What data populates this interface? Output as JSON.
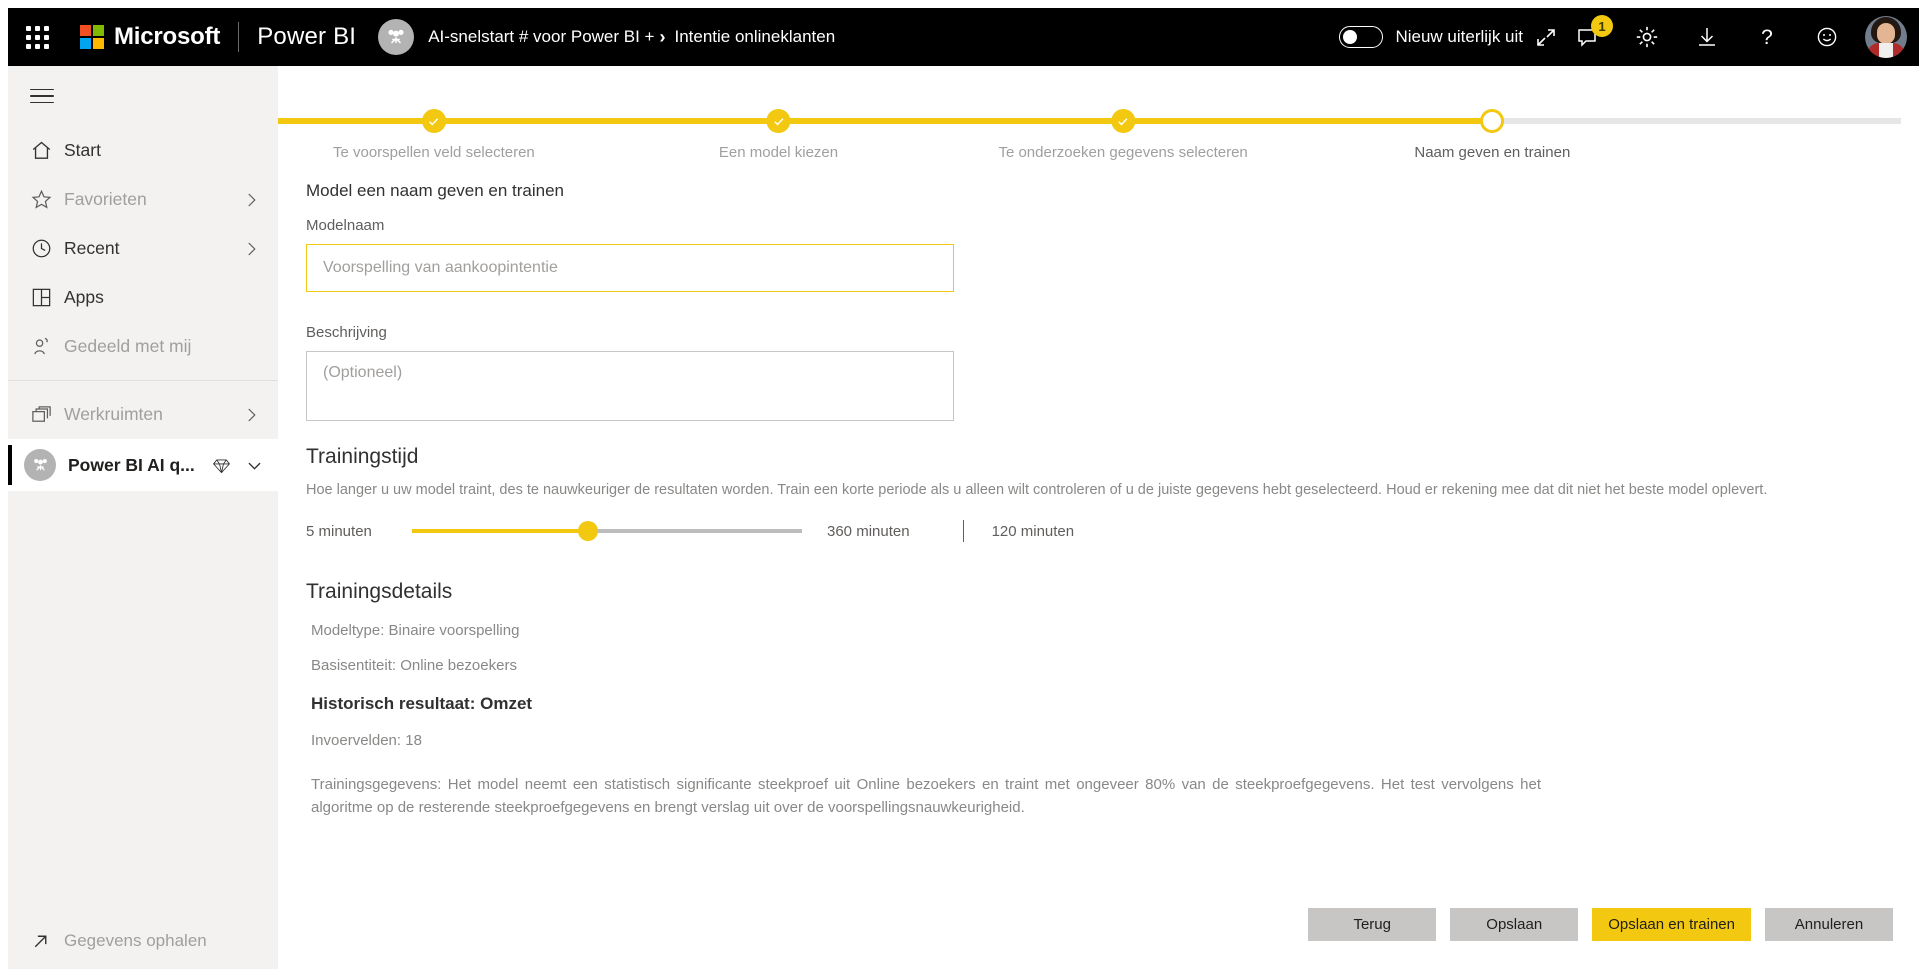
{
  "topbar": {
    "waffle_label": "App launcher",
    "brand": "Microsoft",
    "product": "Power BI",
    "breadcrumb_workspace": "AI-snelstart # voor Power BI +",
    "breadcrumb_separator": "›",
    "breadcrumb_current": "Intentie onlineklanten",
    "toggle_label": "Nieuw uiterlijk uit",
    "toggle_state": "off",
    "notification_count": "1",
    "icons": {
      "feedback": "comment-icon",
      "settings": "gear-icon",
      "download": "download-icon",
      "help": "question-mark-icon",
      "smiley": "smiley-icon",
      "avatar": "user-avatar"
    }
  },
  "sidebar": {
    "hamburger_label": "Navigatie samenvouwen",
    "items": [
      {
        "label": "Start",
        "icon": "home-icon",
        "dim": false,
        "chevron": false
      },
      {
        "label": "Favorieten",
        "icon": "star-icon",
        "dim": true,
        "chevron": true
      },
      {
        "label": "Recent",
        "icon": "clock-icon",
        "dim": false,
        "chevron": true
      },
      {
        "label": "Apps",
        "icon": "apps-grid-icon",
        "dim": false,
        "chevron": false
      },
      {
        "label": "Gedeeld met mij",
        "icon": "shared-person-icon",
        "dim": true,
        "chevron": false
      },
      {
        "label": "Werkruimten",
        "icon": "workspaces-icon",
        "dim": true,
        "chevron": true
      }
    ],
    "workspace": {
      "name": "Power BI AI q...",
      "gem_icon": "diamond-icon",
      "chevron_icon": "chevron-down-icon"
    },
    "get_data": {
      "label": "Gegevens ophalen",
      "icon": "arrow-up-right-icon"
    }
  },
  "stepper": {
    "steps": [
      {
        "label": "Te voorspellen veld selecteren",
        "state": "done",
        "pct": 9.5
      },
      {
        "label": "Een model kiezen",
        "state": "done",
        "pct": 30.5
      },
      {
        "label": "Te onderzoeken gegevens selecteren",
        "state": "done",
        "pct": 51.5
      },
      {
        "label": "Naam geven en trainen",
        "state": "current",
        "pct": 74.0
      }
    ],
    "check_icon": "check-icon",
    "fill_pct": 74.0
  },
  "form": {
    "section_title": "Model een naam geven en trainen",
    "model_name_label": "Modelnaam",
    "model_name_value": "Voorspelling van aankoopintentie",
    "description_label": "Beschrijving",
    "description_placeholder": "(Optioneel)"
  },
  "training_time": {
    "title": "Trainingstijd",
    "help": "Hoe langer u uw model traint, des te nauwkeuriger de resultaten worden. Train een korte periode als u alleen wilt controleren of u de juiste gegevens hebt geselecteerd. Houd er rekening mee dat dit niet het beste model oplevert.",
    "min_label": "5 minuten",
    "max_label": "360 minuten",
    "current_label": "120 minuten",
    "min_value": 5,
    "max_value": 360,
    "current_value": 120,
    "fill_pct": 45
  },
  "training_details": {
    "title": "Trainingsdetails",
    "model_type": "Modeltype:  Binaire voorspelling",
    "base_entity": "Basisentiteit: Online bezoekers",
    "historical_outcome": "Historisch resultaat: Omzet",
    "input_fields": "Invoervelden: 18",
    "training_data_paragraph": "Trainingsgegevens:  Het model neemt een statistisch significante steekproef uit Online bezoekers en traint met ongeveer 80% van de steekproefgegevens. Het test vervolgens het algoritme op de resterende steekproefgegevens en brengt verslag uit over de voorspellingsnauwkeurigheid."
  },
  "footer": {
    "back": "Terug",
    "save": "Opslaan",
    "save_and_train": "Opslaan en trainen",
    "cancel": "Annuleren"
  },
  "colors": {
    "accent_yellow": "#f2c811",
    "topbar_black": "#000000",
    "sidebar_gray": "#f3f2f1",
    "button_gray": "#c8c6c4",
    "muted_text": "#a19f9d"
  }
}
